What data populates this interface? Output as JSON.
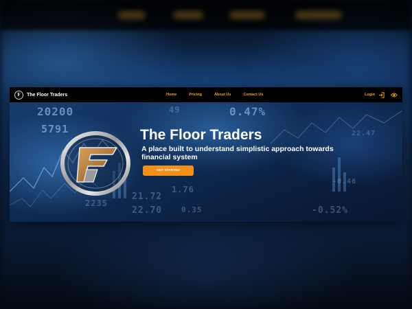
{
  "brand": {
    "name": "The Floor Traders",
    "mark_letter": "F"
  },
  "nav": {
    "links": [
      "Home",
      "Pricing",
      "About Us",
      "Contact Us"
    ],
    "login_label": "Login"
  },
  "hero": {
    "title": "The Floor Traders",
    "subtitle": "A place built to understand simplistic approach towards financial system",
    "cta_label": "GET STARTED"
  },
  "ticker_values": [
    "20200",
    "5791",
    "0.47%",
    "49",
    "2235",
    "21.72",
    "22.70",
    "1.76",
    "-0.46",
    "-0.52%",
    "0.35",
    "22.47"
  ],
  "background_ghost": {
    "nav_links": [
      "Home",
      "Pricing",
      "About Us",
      "Contact Us"
    ]
  },
  "icons": {
    "brand": "floor-traders-logo-icon",
    "login": "login-arrow-icon",
    "theme": "eye-toggle-icon"
  },
  "colors": {
    "accent": "#f0a623",
    "button": "#f2901a",
    "nav_bg": "#000000",
    "text": "#ffffff"
  }
}
